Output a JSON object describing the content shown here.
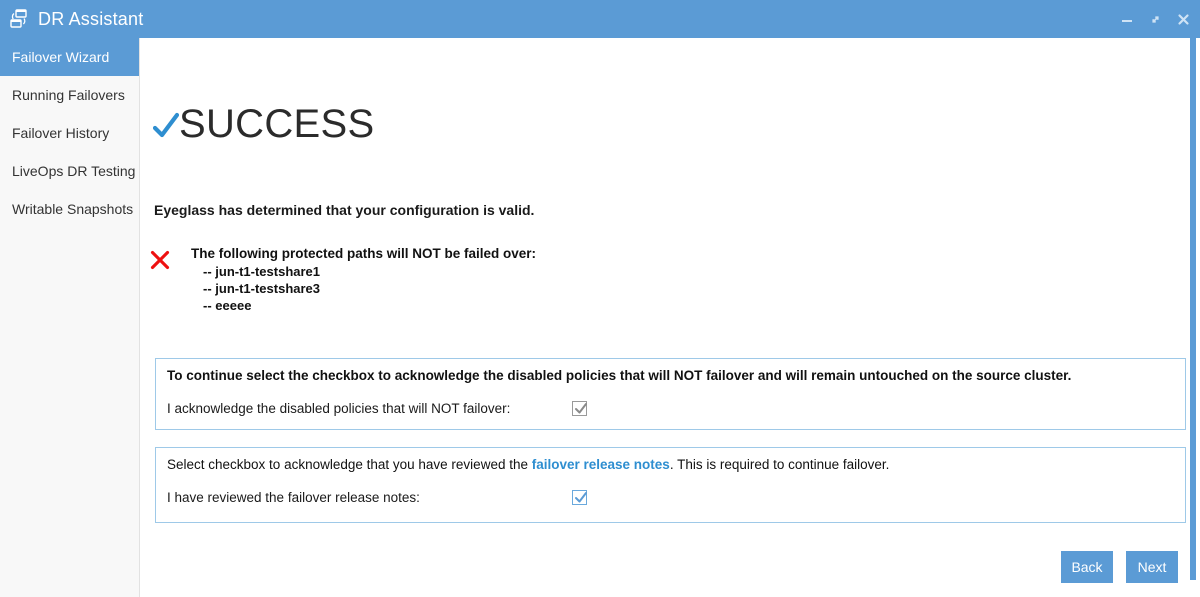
{
  "window": {
    "title": "DR Assistant",
    "app_icon": "replication-icon",
    "controls": [
      {
        "name": "minimize-button",
        "icon": "minimize-icon",
        "label": "–"
      },
      {
        "name": "maximize-button",
        "icon": "maximize-icon",
        "label": "↗"
      },
      {
        "name": "close-button",
        "icon": "close-icon",
        "label": "✕"
      }
    ],
    "colors": {
      "titlebar": "#5b9bd5",
      "accent": "#5b9bd5",
      "link": "#2e8ed0",
      "error": "#ee1111",
      "sidebar_bg": "#f8f8f8",
      "panel_border": "#9ec9e8"
    }
  },
  "sidebar": {
    "items": [
      {
        "label": "Failover Wizard",
        "active": true
      },
      {
        "label": "Running Failovers",
        "active": false
      },
      {
        "label": "Failover History",
        "active": false
      },
      {
        "label": "LiveOps DR Testing",
        "active": false
      },
      {
        "label": "Writable Snapshots",
        "active": false
      }
    ]
  },
  "main": {
    "status_icon": "check-icon",
    "status_title": "SUCCESS",
    "status_subtitle": "Eyeglass has determined that your configuration is valid.",
    "error": {
      "icon": "x-icon",
      "heading": "The following protected paths will NOT be failed over:",
      "items": [
        "-- jun-t1-testshare1",
        "-- jun-t1-testshare3",
        "-- eeeee"
      ]
    },
    "ack_panel": {
      "heading": "To continue select the checkbox to acknowledge the disabled policies that will NOT failover and will remain untouched on the source cluster.",
      "checkbox_label": "I acknowledge the disabled policies that will NOT failover:",
      "checked": true
    },
    "notes_panel": {
      "heading_before": "Select checkbox to acknowledge that you have reviewed the ",
      "heading_link": "failover release notes",
      "heading_after": ". This is required to continue failover.",
      "checkbox_label": "I have reviewed the failover release notes:",
      "checked": true
    }
  },
  "footer": {
    "back_label": "Back",
    "next_label": "Next"
  }
}
